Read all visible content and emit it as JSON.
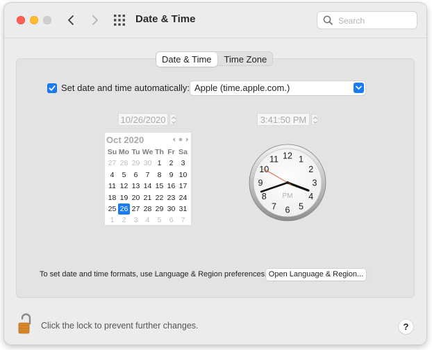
{
  "toolbar": {
    "title": "Date & Time",
    "search_placeholder": "Search"
  },
  "tabs": [
    {
      "label": "Date & Time",
      "active": true
    },
    {
      "label": "Time Zone",
      "active": false
    }
  ],
  "auto_time": {
    "checked": true,
    "label": "Set date and time automatically:",
    "server": "Apple (time.apple.com.)"
  },
  "date_field": "10/26/2020",
  "time_field": "3:41:50 PM",
  "calendar": {
    "month_label": "Oct 2020",
    "weekdays": [
      "Su",
      "Mo",
      "Tu",
      "We",
      "Th",
      "Fr",
      "Sa"
    ],
    "weeks": [
      [
        "27",
        "28",
        "29",
        "30",
        "1",
        "2",
        "3"
      ],
      [
        "4",
        "5",
        "6",
        "7",
        "8",
        "9",
        "10"
      ],
      [
        "11",
        "12",
        "13",
        "14",
        "15",
        "16",
        "17"
      ],
      [
        "18",
        "19",
        "20",
        "21",
        "22",
        "23",
        "24"
      ],
      [
        "25",
        "26",
        "27",
        "28",
        "29",
        "30",
        "31"
      ],
      [
        "1",
        "2",
        "3",
        "4",
        "5",
        "6",
        "7"
      ]
    ],
    "selected_day": "26"
  },
  "clock": {
    "numerals": [
      "12",
      "1",
      "2",
      "3",
      "4",
      "5",
      "6",
      "7",
      "8",
      "9",
      "10",
      "11"
    ],
    "ampm": "PM",
    "hour": 3,
    "minute": 41,
    "second": 50
  },
  "formats_text": "To set date and time formats, use Language & Region preferences.",
  "language_button": "Open Language & Region...",
  "lock_text": "Click the lock to prevent further changes.",
  "help_label": "?",
  "colors": {
    "accent": "#1a7cf0",
    "second_hand": "#e0501e",
    "lock": "#d9892c"
  }
}
